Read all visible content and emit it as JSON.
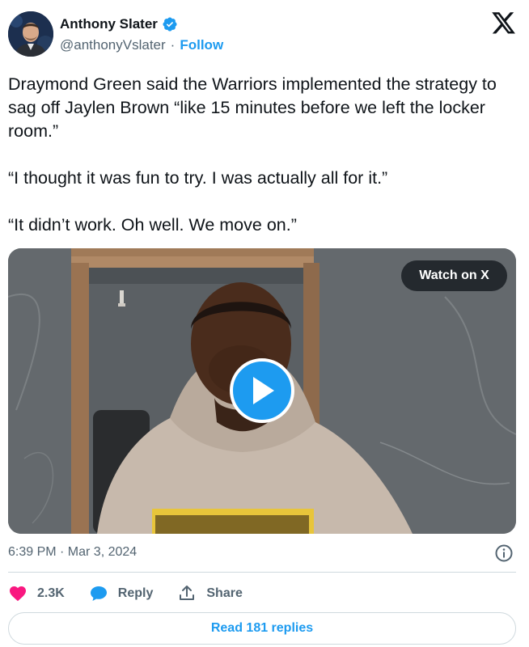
{
  "author": {
    "name": "Anthony Slater",
    "handle": "@anthonyVslater",
    "separator": "·",
    "follow_label": "Follow"
  },
  "tweet": {
    "paragraphs": [
      "Draymond Green said the Warriors implemented the strategy to sag off Jaylen Brown “like 15 minutes before we left the locker room.”",
      "“I thought it was fun to try. I was actually all for it.”",
      "“It didn’t work. Oh well. We move on.”"
    ]
  },
  "media": {
    "watch_label": "Watch on X"
  },
  "meta": {
    "timestamp": "6:39 PM · Mar 3, 2024"
  },
  "actions": {
    "likes": "2.3K",
    "reply_label": "Reply",
    "share_label": "Share"
  },
  "read_replies_label": "Read 181 replies",
  "colors": {
    "accent": "#1d9bf0",
    "like": "#f91880",
    "text": "#0f1419",
    "muted": "#536471",
    "border": "#cfd9de"
  },
  "icons": [
    "verified-badge-icon",
    "x-logo-icon",
    "play-icon",
    "info-icon",
    "heart-icon",
    "reply-bubble-icon",
    "share-icon"
  ]
}
